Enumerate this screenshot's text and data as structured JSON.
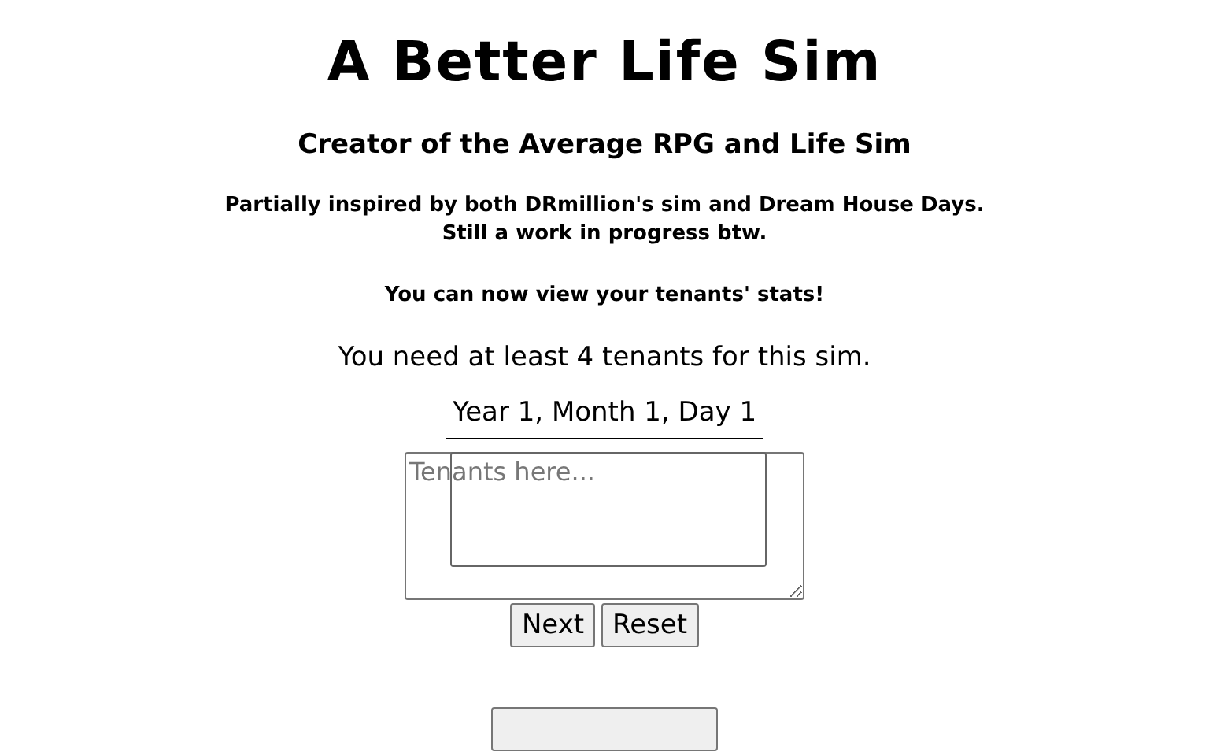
{
  "title": "A Better Life Sim",
  "subtitle": "Creator of the Average RPG and Life Sim",
  "notes": [
    "Partially inspired by both DRmillion's sim and Dream House Days.",
    "Still a work in progress btw."
  ],
  "announcement": "You can now view your tenants' stats!",
  "requirement": "You need at least 4 tenants for this sim.",
  "date": "Year 1, Month 1, Day 1",
  "tenants_field": {
    "placeholder": "Tenants here..."
  },
  "buttons": [
    {
      "label": "Next"
    },
    {
      "label": "Reset"
    }
  ],
  "lower_buttons": [
    {
      "kind": "cut"
    }
  ]
}
